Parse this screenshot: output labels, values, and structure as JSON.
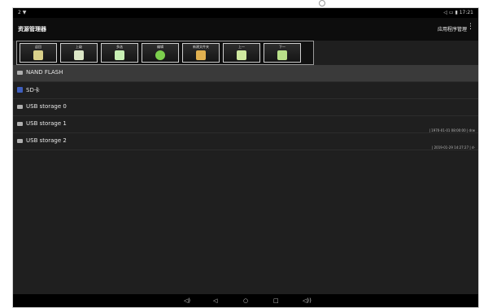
{
  "status": {
    "left": "2  ▼",
    "right": "◁ ▭ ▮ 17:21"
  },
  "app": {
    "title": "资源管理器",
    "right_label": "应用程序管理",
    "overflow": "⋮"
  },
  "toolbar": {
    "items": [
      {
        "label": "返回",
        "icon": "home-folder-icon",
        "color": "#d9d08a"
      },
      {
        "label": "上级",
        "icon": "up-folder-icon",
        "color": "#dbe6c6"
      },
      {
        "label": "多选",
        "icon": "multi-select-icon",
        "color": "#c8f0b5"
      },
      {
        "label": "编辑",
        "icon": "edit-icon",
        "color": "#7ccf4d"
      },
      {
        "label": "新建文件夹",
        "icon": "new-folder-icon",
        "color": "#e0b050"
      },
      {
        "label": "上一",
        "icon": "prev-icon",
        "color": "#cfe8a0"
      },
      {
        "label": "下一",
        "icon": "next-icon",
        "color": "#b9e08a"
      }
    ]
  },
  "list": {
    "items": [
      {
        "label": "NAND FLASH",
        "meta": ""
      },
      {
        "label": "SD卡",
        "meta": ""
      },
      {
        "label": "USB storage 0",
        "meta": ""
      },
      {
        "label": "USB storage 1",
        "meta": "| 1970-01-01 08:00:00 | drw"
      },
      {
        "label": "USB storage 2",
        "meta": "| 2019-01-29 14:27:27 | d-"
      }
    ]
  },
  "nav": {
    "vol_down": "◁)",
    "back": "◁",
    "home": "○",
    "recent": "□",
    "vol_up": "◁))"
  }
}
